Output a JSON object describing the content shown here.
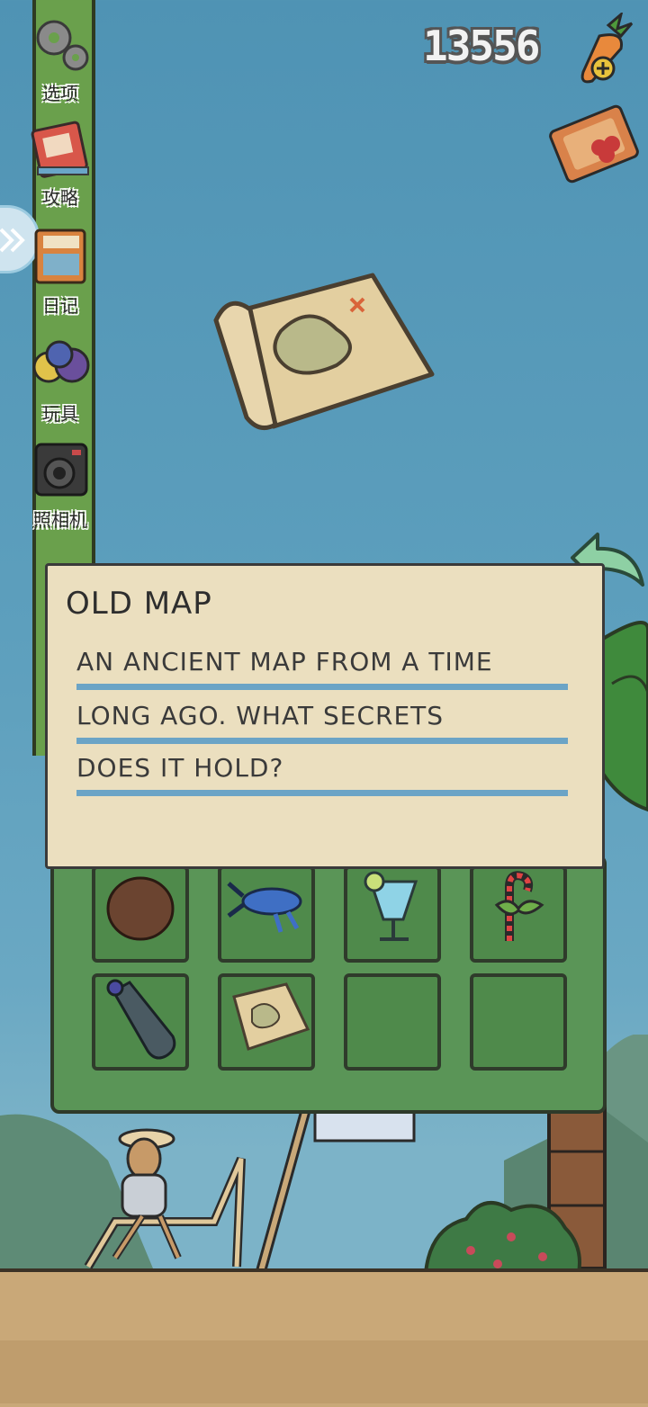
{
  "sidebar": {
    "items": [
      {
        "label": "选项",
        "icon": "gear-icon"
      },
      {
        "label": "攻略",
        "icon": "guide-book-icon"
      },
      {
        "label": "日记",
        "icon": "diary-icon"
      },
      {
        "label": "玩具",
        "icon": "toys-icon"
      },
      {
        "label": "照相机",
        "icon": "camera-icon"
      }
    ],
    "expand_icon": "chevron-double-right-icon"
  },
  "currency": {
    "carrots": "13556",
    "add_icon": "carrot-plus-icon",
    "ticket_icon": "ticket-icon"
  },
  "item_detail": {
    "title": "OLD MAP",
    "description_lines": [
      "AN ANCIENT MAP FROM A TIME",
      "LONG AGO. WHAT SECRETS",
      "DOES IT HOLD?"
    ],
    "back_icon": "back-arrow-icon"
  },
  "inventory": {
    "slots": [
      {
        "item": "coconut"
      },
      {
        "item": "blue-lobster"
      },
      {
        "item": "tropical-drink"
      },
      {
        "item": "candy-cane-bow"
      },
      {
        "item": "plastic-bottle"
      },
      {
        "item": "old-map"
      },
      {
        "item": ""
      },
      {
        "item": ""
      }
    ]
  },
  "colors": {
    "sky": "#5a9cbc",
    "sidebar": "#6aa04c",
    "panel": "#ebdfbf",
    "inventory": "#5a9557",
    "underline": "#6ba4c6"
  }
}
